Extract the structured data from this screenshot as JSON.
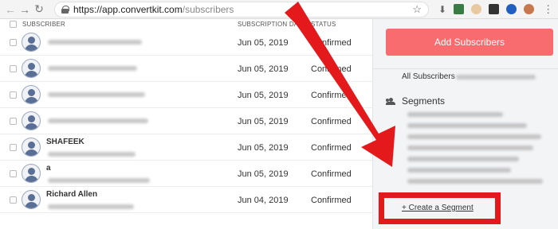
{
  "browser": {
    "url_host": "https://app.convertkit.com",
    "url_path": "/subscribers",
    "extensions": [
      "download-icon",
      "green-ext-icon",
      "dog-ext-icon",
      "dark-ext-icon",
      "blue-ext-icon",
      "avatar-icon"
    ]
  },
  "table": {
    "headers": {
      "subscriber": "SUBSCRIBER",
      "subscription_date": "SUBSCRIPTION DA",
      "status": "STATUS"
    },
    "rows": [
      {
        "name": "",
        "date": "Jun 05, 2019",
        "status": "Confirmed"
      },
      {
        "name": "",
        "date": "Jun 05, 2019",
        "status": "Confirmed"
      },
      {
        "name": "",
        "date": "Jun 05, 2019",
        "status": "Confirmed"
      },
      {
        "name": "",
        "date": "Jun 05, 2019",
        "status": "Confirmed"
      },
      {
        "name": "SHAFEEK",
        "date": "Jun 05, 2019",
        "status": "Confirmed"
      },
      {
        "name": "a",
        "date": "Jun 05, 2019",
        "status": "Confirmed"
      },
      {
        "name": "Richard Allen",
        "date": "Jun 04, 2019",
        "status": "Confirmed"
      }
    ]
  },
  "sidebar": {
    "add_button": "Add Subscribers",
    "all_subscribers": "All Subscribers",
    "segments_title": "Segments",
    "create_segment": "+ Create a Segment"
  },
  "annotation": {
    "arrow_color": "#e3191b",
    "box_color": "#e3191b"
  }
}
